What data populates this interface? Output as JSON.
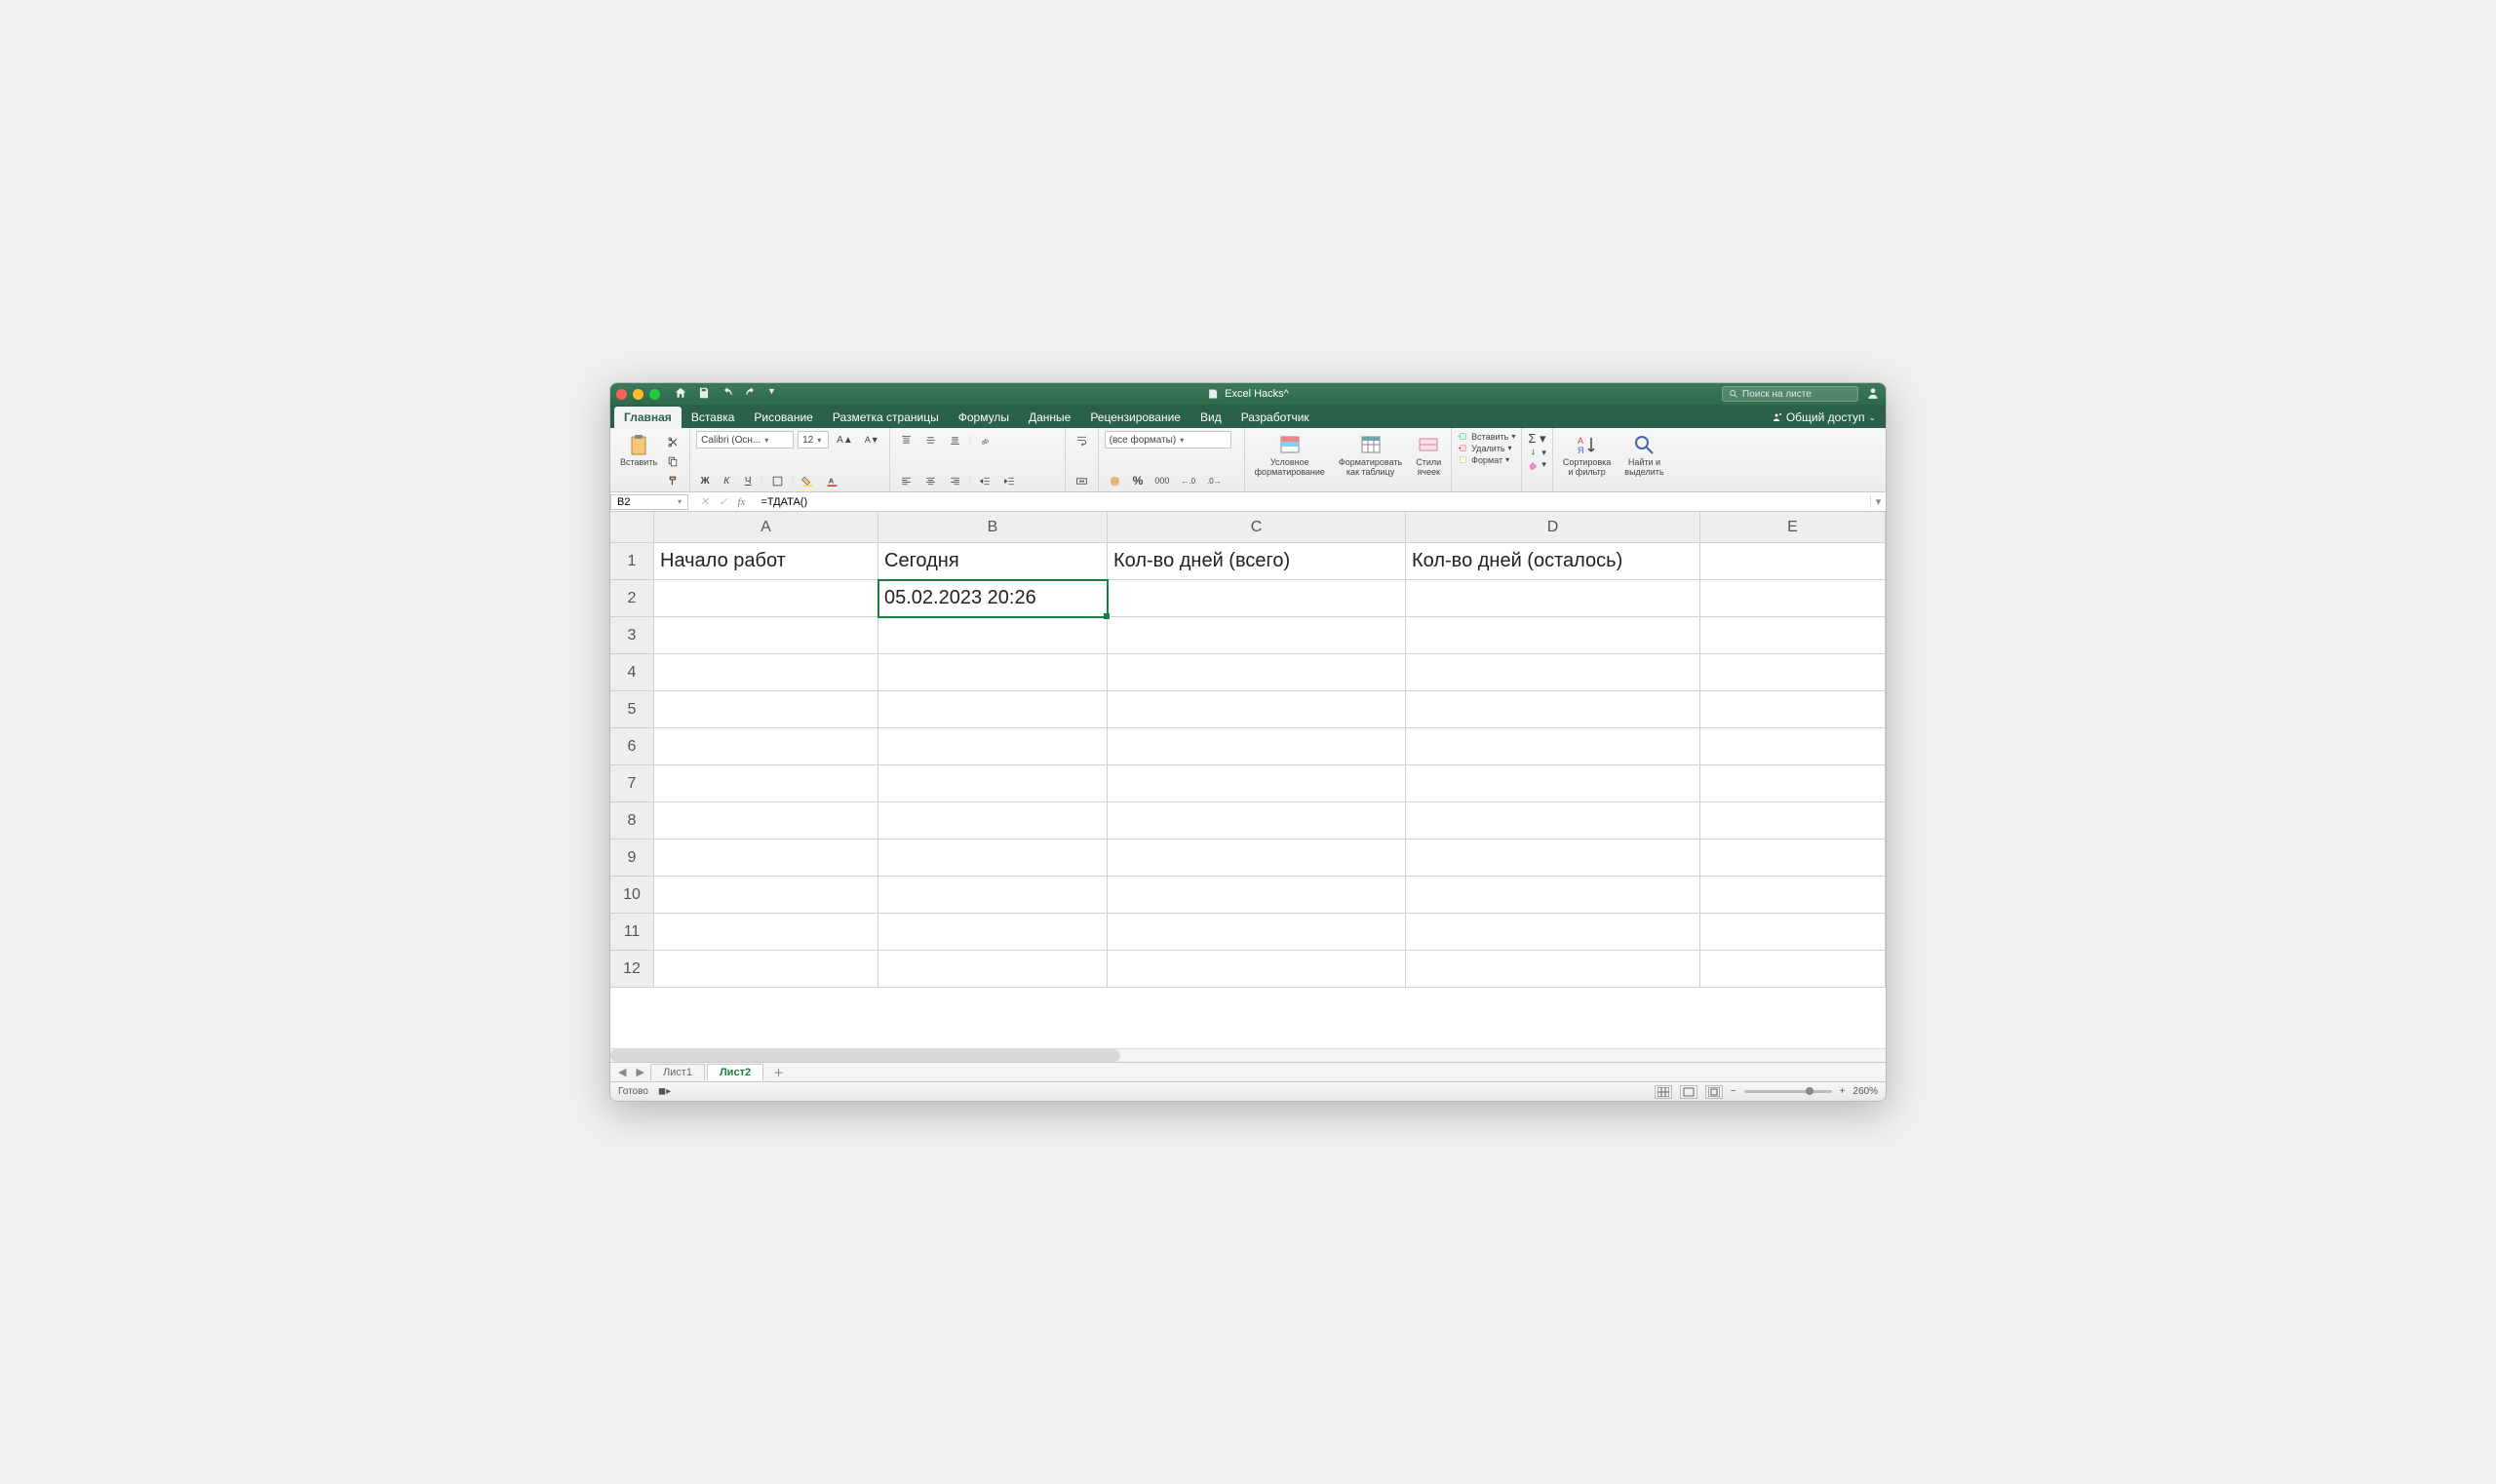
{
  "title": "Excel Hacks^",
  "search_placeholder": "Поиск на листе",
  "tabs": [
    "Главная",
    "Вставка",
    "Рисование",
    "Разметка страницы",
    "Формулы",
    "Данные",
    "Рецензирование",
    "Вид",
    "Разработчик"
  ],
  "active_tab": 0,
  "share_label": "Общий доступ",
  "ribbon": {
    "paste": "Вставить",
    "font_name": "Calibri (Осн...",
    "font_size": "12",
    "bold": "Ж",
    "italic": "К",
    "underline": "Ч",
    "number_format": "(все форматы)",
    "cond_format": "Условное\nформатирование",
    "format_table": "Форматировать\nкак таблицу",
    "cell_styles": "Стили\nячеек",
    "insert": "Вставить",
    "delete": "Удалить",
    "format": "Формат",
    "sort": "Сортировка\nи фильтр",
    "find": "Найти и\nвыделить"
  },
  "name_box": "B2",
  "formula": "=ТДАТА()",
  "columns": [
    "A",
    "B",
    "C",
    "D",
    "E"
  ],
  "row_count": 12,
  "cells": {
    "A1": "Начало работ",
    "B1": "Сегодня",
    "C1": "Кол-во дней (всего)",
    "D1": "Кол-во дней (осталось)",
    "B2": "05.02.2023 20:26"
  },
  "selected": "B2",
  "sheets": [
    "Лист1",
    "Лист2"
  ],
  "active_sheet": 1,
  "status": "Готово",
  "zoom": "260%"
}
